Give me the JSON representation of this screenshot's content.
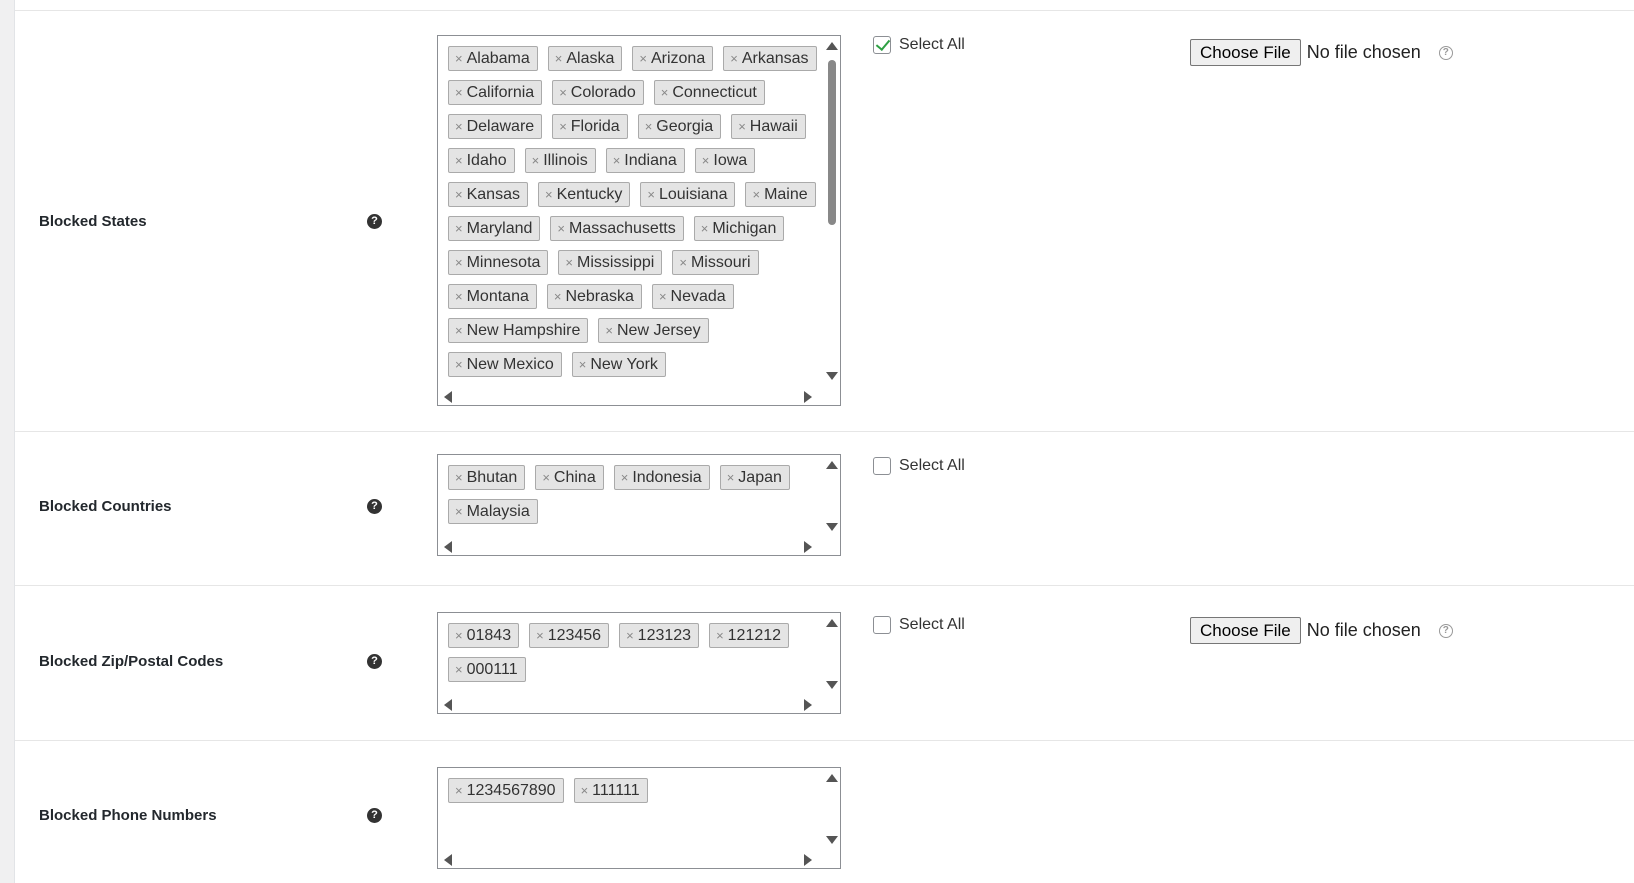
{
  "rows": {
    "states": {
      "label": "Blocked States",
      "tags": [
        "Alabama",
        "Alaska",
        "Arizona",
        "Arkansas",
        "California",
        "Colorado",
        "Connecticut",
        "Delaware",
        "Florida",
        "Georgia",
        "Hawaii",
        "Idaho",
        "Illinois",
        "Indiana",
        "Iowa",
        "Kansas",
        "Kentucky",
        "Louisiana",
        "Maine",
        "Maryland",
        "Massachusetts",
        "Michigan",
        "Minnesota",
        "Mississippi",
        "Missouri",
        "Montana",
        "Nebraska",
        "Nevada",
        "New Hampshire",
        "New Jersey",
        "New Mexico",
        "New York"
      ],
      "select_all_label": "Select All",
      "select_all_checked": true,
      "file_button": "Choose File",
      "file_status": "No file chosen"
    },
    "countries": {
      "label": "Blocked Countries",
      "tags": [
        "Bhutan",
        "China",
        "Indonesia",
        "Japan",
        "Malaysia"
      ],
      "select_all_label": "Select All",
      "select_all_checked": false
    },
    "zip": {
      "label": "Blocked Zip/Postal Codes",
      "tags": [
        "01843",
        "123456",
        "123123",
        "121212",
        "000111"
      ],
      "select_all_label": "Select All",
      "select_all_checked": false,
      "file_button": "Choose File",
      "file_status": "No file chosen"
    },
    "phone": {
      "label": "Blocked Phone Numbers",
      "tags": [
        "1234567890",
        "111111"
      ]
    }
  },
  "tag_remove_glyph": "×",
  "help_glyph": "?",
  "colors": {
    "check_accent": "#2ea043",
    "tag_bg": "#e4e4e4"
  }
}
